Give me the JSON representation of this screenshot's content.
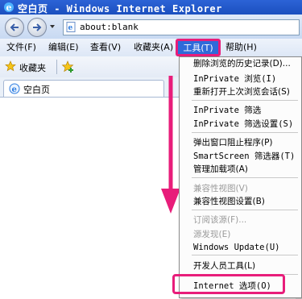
{
  "window": {
    "title": "空白页 - Windows Internet Explorer"
  },
  "address": {
    "value": "about:blank"
  },
  "menu": {
    "file": "文件(F)",
    "edit": "编辑(E)",
    "view": "查看(V)",
    "favorites": "收藏夹(A)",
    "tools": "工具(T)",
    "help": "帮助(H)"
  },
  "favorites_bar": {
    "label": "收藏夹"
  },
  "tab": {
    "label": "空白页"
  },
  "tools_menu": {
    "items": [
      {
        "label": "删除浏览的历史记录(D)...",
        "enabled": true
      },
      {
        "label": "InPrivate 浏览(I)",
        "enabled": true
      },
      {
        "label": "重新打开上次浏览会话(S)",
        "enabled": true
      },
      {
        "label": "InPrivate 筛选",
        "enabled": true
      },
      {
        "label": "InPrivate 筛选设置(S)",
        "enabled": true
      },
      {
        "label": "弹出窗口阻止程序(P)",
        "enabled": true
      },
      {
        "label": "SmartScreen 筛选器(T)",
        "enabled": true
      },
      {
        "label": "管理加载项(A)",
        "enabled": true
      },
      {
        "label": "兼容性视图(V)",
        "enabled": false
      },
      {
        "label": "兼容性视图设置(B)",
        "enabled": true
      },
      {
        "label": "订阅该源(F)...",
        "enabled": false
      },
      {
        "label": "源发现(E)",
        "enabled": false
      },
      {
        "label": "Windows Update(U)",
        "enabled": true
      },
      {
        "label": "开发人员工具(L)",
        "enabled": true
      },
      {
        "label": "Internet 选项(O)",
        "enabled": true
      }
    ]
  },
  "colors": {
    "highlight": "#e81d7a",
    "titlebar": "#2c63d6",
    "menu_selected": "#2f6ad9"
  }
}
